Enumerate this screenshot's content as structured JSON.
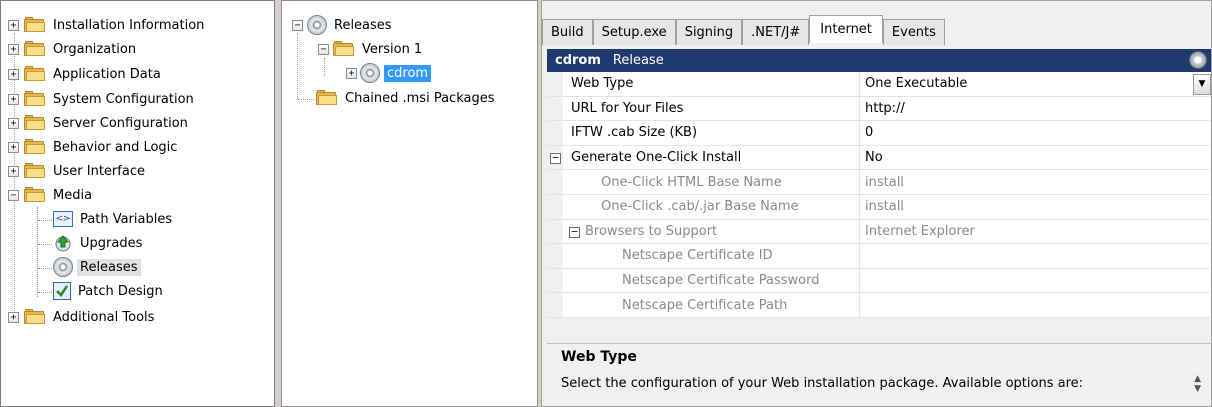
{
  "left_tree": {
    "items": [
      {
        "label": "Installation Information",
        "icon": "folder-icon",
        "expander": "+"
      },
      {
        "label": "Organization",
        "icon": "folder-icon",
        "expander": "+"
      },
      {
        "label": "Application Data",
        "icon": "folder-icon",
        "expander": "+"
      },
      {
        "label": "System Configuration",
        "icon": "folder-icon",
        "expander": "+"
      },
      {
        "label": "Server Configuration",
        "icon": "folder-icon",
        "expander": "+"
      },
      {
        "label": "Behavior and Logic",
        "icon": "folder-icon",
        "expander": "+"
      },
      {
        "label": "User Interface",
        "icon": "folder-icon",
        "expander": "+"
      },
      {
        "label": "Media",
        "icon": "folder-icon",
        "expander": "−"
      },
      {
        "label": "Path Variables",
        "icon": "path-variables-icon"
      },
      {
        "label": "Upgrades",
        "icon": "upgrades-icon"
      },
      {
        "label": "Releases",
        "icon": "disc-icon"
      },
      {
        "label": "Patch Design",
        "icon": "patch-design-icon"
      },
      {
        "label": "Additional Tools",
        "icon": "folder-icon",
        "expander": "+"
      }
    ]
  },
  "mid_tree": {
    "releases": "Releases",
    "version": "Version 1",
    "cdrom": "cdrom",
    "chained": "Chained .msi Packages",
    "expander_open": "−",
    "expander_closed": "+"
  },
  "tabs": [
    {
      "label": "Build"
    },
    {
      "label": "Setup.exe"
    },
    {
      "label": "Signing"
    },
    {
      "label": ".NET/J#"
    },
    {
      "label": "Internet",
      "active": true
    },
    {
      "label": "Events"
    }
  ],
  "prop_header": {
    "name": "cdrom",
    "type": "Release"
  },
  "properties": [
    {
      "key": "Web Type",
      "value": "One Executable",
      "dropdown": true
    },
    {
      "key": "URL for Your Files",
      "value": "http://"
    },
    {
      "key": "IFTW .cab Size (KB)",
      "value": "0"
    },
    {
      "key": "Generate One-Click Install",
      "value": "No",
      "expander": "−"
    },
    {
      "key": "One-Click HTML Base Name",
      "value": "install",
      "dim": true
    },
    {
      "key": "One-Click .cab/.jar Base Name",
      "value": "install",
      "dim": true
    },
    {
      "key": "Browsers to Support",
      "value": "Internet Explorer",
      "dim": true,
      "expander": "−"
    },
    {
      "key": "Netscape Certificate ID",
      "value": "",
      "dim": true
    },
    {
      "key": "Netscape Certificate Password",
      "value": "",
      "dim": true
    },
    {
      "key": "Netscape Certificate Path",
      "value": "",
      "dim": true
    }
  ],
  "description": {
    "title": "Web Type",
    "text": "Select the configuration of your Web installation package. Available options are:"
  },
  "glyphs": {
    "dropdown_arrow": "▼",
    "spin_up": "▲",
    "spin_down": "▼",
    "path_var": "<>"
  }
}
